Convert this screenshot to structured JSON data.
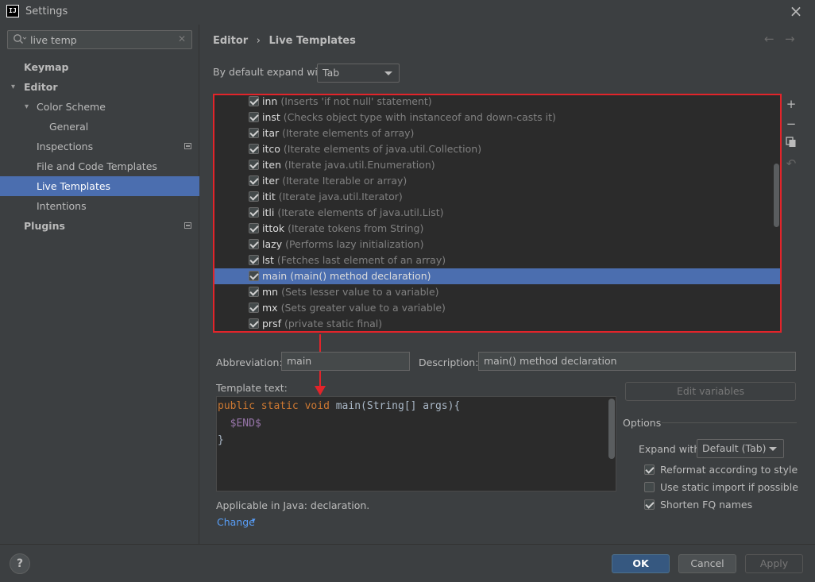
{
  "window": {
    "title": "Settings",
    "app_icon": "IJ"
  },
  "search": {
    "value": "live temp",
    "placeholder": ""
  },
  "sidebar": {
    "items": [
      {
        "label": "Keymap"
      },
      {
        "label": "Editor"
      },
      {
        "label": "Color Scheme"
      },
      {
        "label": "General"
      },
      {
        "label": "Inspections"
      },
      {
        "label": "File and Code Templates"
      },
      {
        "label": "Live Templates"
      },
      {
        "label": "Intentions"
      },
      {
        "label": "Plugins"
      }
    ]
  },
  "breadcrumb": {
    "parent": "Editor",
    "sep": "›",
    "current": "Live Templates"
  },
  "expand": {
    "label": "By default expand with",
    "value": "Tab"
  },
  "templates": [
    {
      "abbr": "inn",
      "desc": "(Inserts 'if not null' statement)"
    },
    {
      "abbr": "inst",
      "desc": "(Checks object type with instanceof and down-casts it)"
    },
    {
      "abbr": "itar",
      "desc": "(Iterate elements of array)"
    },
    {
      "abbr": "itco",
      "desc": "(Iterate elements of java.util.Collection)"
    },
    {
      "abbr": "iten",
      "desc": "(Iterate java.util.Enumeration)"
    },
    {
      "abbr": "iter",
      "desc": "(Iterate Iterable or array)"
    },
    {
      "abbr": "itit",
      "desc": "(Iterate java.util.Iterator)"
    },
    {
      "abbr": "itli",
      "desc": "(Iterate elements of java.util.List)"
    },
    {
      "abbr": "ittok",
      "desc": "(Iterate tokens from String)"
    },
    {
      "abbr": "lazy",
      "desc": "(Performs lazy initialization)"
    },
    {
      "abbr": "lst",
      "desc": "(Fetches last element of an array)"
    },
    {
      "abbr": "main",
      "desc": "(main() method declaration)"
    },
    {
      "abbr": "mn",
      "desc": "(Sets lesser value to a variable)"
    },
    {
      "abbr": "mx",
      "desc": "(Sets greater value to a variable)"
    },
    {
      "abbr": "prsf",
      "desc": "(private static final)"
    }
  ],
  "detail": {
    "abbreviation_label": "Abbreviation:",
    "abbreviation_value": "main",
    "description_label": "Description:",
    "description_value": "main() method declaration",
    "template_text_label": "Template text:",
    "edit_variables": "Edit variables",
    "code": {
      "kw1": "public",
      "kw2": "static",
      "kw3": "void",
      "sig": "main(String[] args){",
      "var": "$END$",
      "close": "}"
    },
    "applicable": "Applicable in Java: declaration.",
    "change": "Change"
  },
  "options": {
    "title": "Options",
    "expand_with_label": "Expand with",
    "expand_with_value": "Default (Tab)",
    "reformat": "Reformat according to style",
    "static_import": "Use static import if possible",
    "shorten_fq": "Shorten FQ names"
  },
  "footer": {
    "help": "?",
    "ok": "OK",
    "cancel": "Cancel",
    "apply": "Apply"
  },
  "colors": {
    "selection": "#4b6eaf",
    "highlight_border": "#e2242a",
    "link": "#589df6",
    "keyword": "#cc7832"
  }
}
